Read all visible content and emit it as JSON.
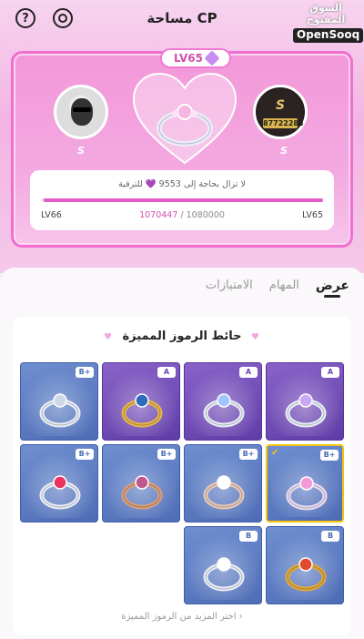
{
  "header": {
    "title": "مساحة CP",
    "help_icon": "question-icon",
    "settings_icon": "gear-icon",
    "watermark_ar": "السوق المفتوح",
    "watermark_en": "OpenSooq"
  },
  "cp": {
    "level": "LV65",
    "left_name": "S",
    "right_name": "S",
    "right_logo": "S",
    "right_number": "87722288",
    "progress_text": "لا تزال بحاجة إلى 9553 💜 للترقية",
    "current_level": "LV65",
    "next_level": "LV66",
    "xp_current": "1070447",
    "xp_sep": " / ",
    "xp_total": "1080000",
    "progress_fraction": 0.991
  },
  "tabs": [
    {
      "label": "عرض",
      "active": true
    },
    {
      "label": "المهام",
      "active": false
    },
    {
      "label": "الامتيازات",
      "active": false
    }
  ],
  "wall": {
    "title": "حائط الرموز المميزة",
    "more_link": "اختر المزيد من الرموز المميزة ›",
    "deco": "♥",
    "items": [
      {
        "badge": "A",
        "tier": "purple",
        "selected": false,
        "stone": "#c9a7f5",
        "band": "#e8eef7"
      },
      {
        "badge": "A",
        "tier": "purple",
        "selected": false,
        "stone": "#9ec7ff",
        "band": "#e8eef7"
      },
      {
        "badge": "A",
        "tier": "purple",
        "selected": false,
        "stone": "#2c6bbd",
        "band": "#e5b54a"
      },
      {
        "badge": "B+",
        "tier": "blue",
        "selected": false,
        "stone": "#cfd8e8",
        "band": "#e8eef7"
      },
      {
        "badge": "B+",
        "tier": "blue",
        "selected": true,
        "stone": "#f19ad8",
        "band": "#eadcf2"
      },
      {
        "badge": "B+",
        "tier": "blue",
        "selected": false,
        "stone": "#ffffff",
        "band": "#e7c9b8"
      },
      {
        "badge": "B+",
        "tier": "blue",
        "selected": false,
        "stone": "#c0588f",
        "band": "#d9a07a"
      },
      {
        "badge": "B+",
        "tier": "blue",
        "selected": false,
        "stone": "#e7335e",
        "band": "#e8eef7"
      },
      {
        "badge": "B",
        "tier": "blue",
        "selected": false,
        "stone": "#e04a2e",
        "band": "#e2a93a"
      },
      {
        "badge": "B",
        "tier": "blue",
        "selected": false,
        "stone": "#ffffff",
        "band": "#e8eef7"
      }
    ]
  }
}
